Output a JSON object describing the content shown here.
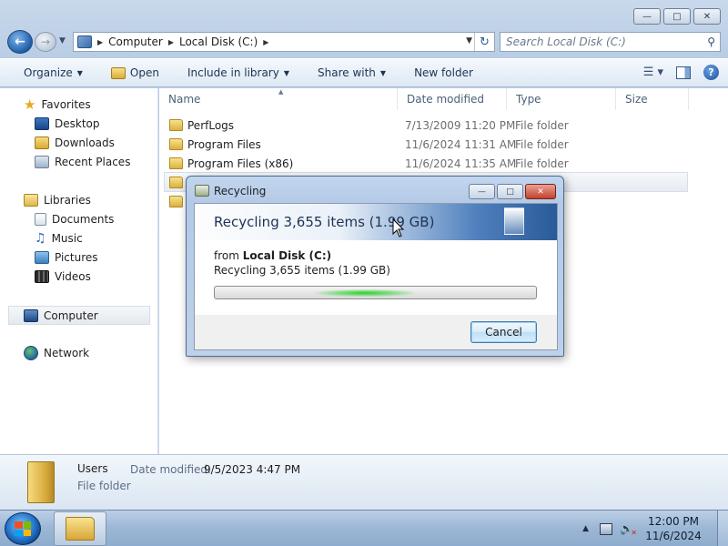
{
  "explorer": {
    "address": {
      "crumbs": [
        "Computer",
        "Local Disk (C:)"
      ]
    },
    "search": {
      "placeholder": "Search Local Disk (C:)"
    },
    "toolbar": {
      "organize": "Organize",
      "open": "Open",
      "include": "Include in library",
      "share": "Share with",
      "new_folder": "New folder"
    },
    "nav": {
      "favorites": "Favorites",
      "desktop": "Desktop",
      "downloads": "Downloads",
      "recent": "Recent Places",
      "libraries": "Libraries",
      "documents": "Documents",
      "music": "Music",
      "pictures": "Pictures",
      "videos": "Videos",
      "computer": "Computer",
      "network": "Network"
    },
    "columns": {
      "name": "Name",
      "date": "Date modified",
      "type": "Type",
      "size": "Size"
    },
    "rows": [
      {
        "name": "PerfLogs",
        "date": "7/13/2009 11:20 PM",
        "type": "File folder"
      },
      {
        "name": "Program Files",
        "date": "11/6/2024 11:31 AM",
        "type": "File folder"
      },
      {
        "name": "Program Files (x86)",
        "date": "11/6/2024 11:35 AM",
        "type": "File folder"
      }
    ],
    "details": {
      "name": "Users",
      "modified_label": "Date modified:",
      "modified_value": "9/5/2023 4:47 PM",
      "type": "File folder"
    }
  },
  "dialog": {
    "title": "Recycling",
    "heading": "Recycling 3,655 items (1.99 GB)",
    "from_label": "from",
    "from_location": "Local Disk (C:)",
    "status": "Recycling 3,655 items (1.99 GB)",
    "cancel": "Cancel",
    "progress_state": "indeterminate"
  },
  "taskbar": {
    "time": "12:00 PM",
    "date": "11/6/2024"
  },
  "icons": {
    "start": "windows-logo",
    "explorer": "folder-icon",
    "tray": [
      "network-icon",
      "volume-muted-icon"
    ]
  }
}
